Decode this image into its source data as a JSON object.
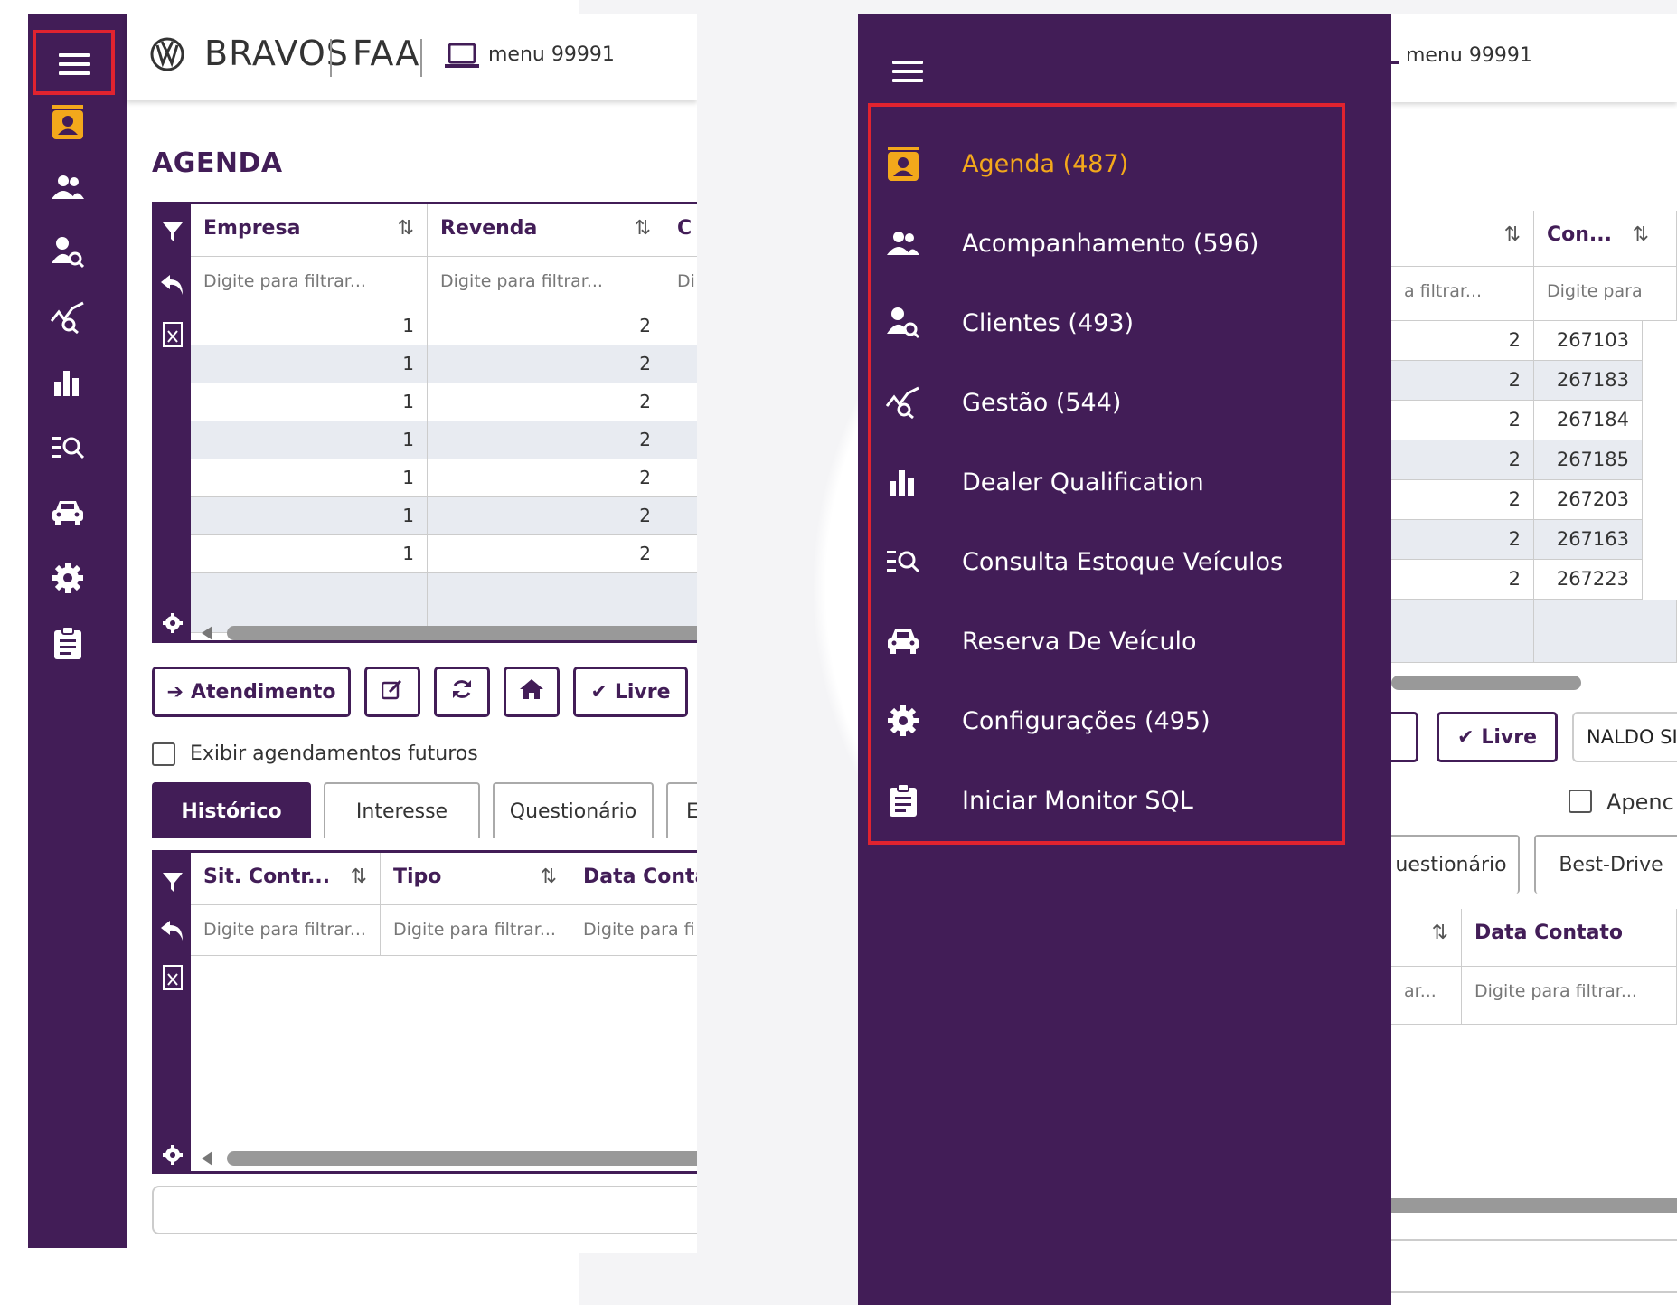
{
  "colors": {
    "primary": "#421d57",
    "accent": "#f3a81b",
    "highlight": "#e0232f",
    "stripe": "#e8ebf1"
  },
  "header": {
    "brand_logo": "vw-logo-icon",
    "brand": "BRAVOS",
    "unit": "FAA",
    "menu_icon": "laptop-icon",
    "menu_label": "menu 99991"
  },
  "left": {
    "page_title": "AGENDA",
    "rail_icons": [
      "contact-card-icon",
      "group-icon",
      "user-search-icon",
      "chart-search-icon",
      "bar-chart-icon",
      "list-search-icon",
      "car-icon",
      "gear-icon",
      "clipboard-icon"
    ],
    "grid1": {
      "columns": [
        {
          "label": "Empresa",
          "filter": "Digite para filtrar..."
        },
        {
          "label": "Revenda",
          "filter": "Digite para filtrar..."
        },
        {
          "label": "C",
          "filter": "Di"
        }
      ],
      "rows": [
        [
          "1",
          "2"
        ],
        [
          "1",
          "2"
        ],
        [
          "1",
          "2"
        ],
        [
          "1",
          "2"
        ],
        [
          "1",
          "2"
        ],
        [
          "1",
          "2"
        ],
        [
          "1",
          "2"
        ]
      ]
    },
    "buttons": {
      "atendimento": "Atendimento",
      "livre": "Livre"
    },
    "checkbox_label": "Exibir agendamentos futuros",
    "tabs": [
      "Histórico",
      "Interesse",
      "Questionário",
      "E"
    ],
    "grid2": {
      "columns": [
        {
          "label": "Sit. Contr...",
          "filter": "Digite para filtrar..."
        },
        {
          "label": "Tipo",
          "filter": "Digite para filtrar..."
        },
        {
          "label": "Data Conta",
          "filter": "Digite para fi"
        }
      ]
    }
  },
  "right": {
    "menu_label": "menu 99991",
    "menu": [
      {
        "label": "Agenda (487)",
        "icon": "contact-card-icon",
        "active": true
      },
      {
        "label": "Acompanhamento (596)",
        "icon": "group-icon"
      },
      {
        "label": "Clientes (493)",
        "icon": "user-search-icon"
      },
      {
        "label": "Gestão (544)",
        "icon": "chart-search-icon"
      },
      {
        "label": "Dealer Qualification",
        "icon": "bar-chart-icon"
      },
      {
        "label": "Consulta Estoque Veículos",
        "icon": "list-search-icon"
      },
      {
        "label": "Reserva De Veículo",
        "icon": "car-icon"
      },
      {
        "label": "Configurações (495)",
        "icon": "gear-icon"
      },
      {
        "label": "Iniciar Monitor SQL",
        "icon": "clipboard-icon"
      }
    ],
    "grid1": {
      "col_con": "Con...",
      "filter_a": "a filtrar...",
      "filter_b": "Digite para",
      "rows": [
        [
          "2",
          "267103"
        ],
        [
          "2",
          "267183"
        ],
        [
          "2",
          "267184"
        ],
        [
          "2",
          "267185"
        ],
        [
          "2",
          "267203"
        ],
        [
          "2",
          "267163"
        ],
        [
          "2",
          "267223"
        ]
      ]
    },
    "livre": "Livre",
    "name_field": "NALDO SI",
    "checkbox_label": "Apenc",
    "tabs": [
      "uestionário",
      "Best-Drive"
    ],
    "grid2": {
      "col_data": "Data Contato",
      "filter_a": "ar...",
      "filter_b": "Digite para filtrar..."
    }
  }
}
